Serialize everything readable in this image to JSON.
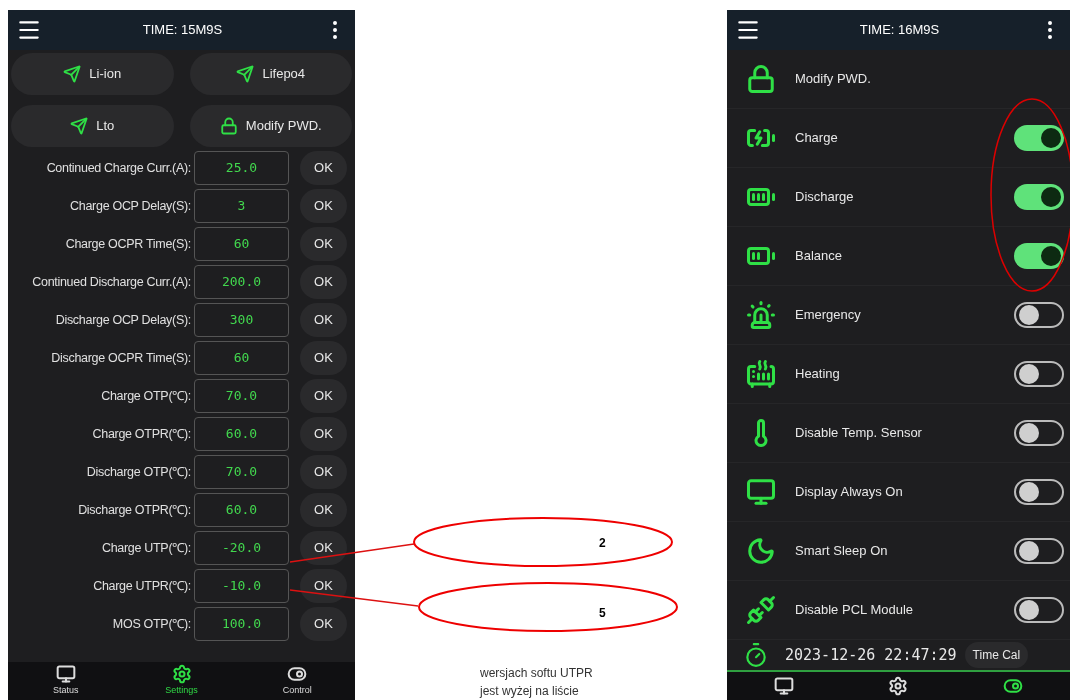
{
  "left_screen": {
    "title": "TIME: 15M9S",
    "mode_buttons": [
      {
        "label": "Li-ion",
        "kind": "plane"
      },
      {
        "label": "Lifepo4",
        "kind": "plane"
      },
      {
        "label": "Lto",
        "kind": "plane"
      },
      {
        "label": "Modify PWD.",
        "kind": "lock"
      }
    ],
    "parameters": [
      {
        "label": "Continued Charge Curr.(A):",
        "value": "25.0",
        "button": "OK"
      },
      {
        "label": "Charge OCP Delay(S):",
        "value": "3",
        "button": "OK"
      },
      {
        "label": "Charge OCPR Time(S):",
        "value": "60",
        "button": "OK"
      },
      {
        "label": "Continued Discharge Curr.(A):",
        "value": "200.0",
        "button": "OK"
      },
      {
        "label": "Discharge OCP Delay(S):",
        "value": "300",
        "button": "OK"
      },
      {
        "label": "Discharge OCPR Time(S):",
        "value": "60",
        "button": "OK"
      },
      {
        "label": "Charge OTP(℃):",
        "value": "70.0",
        "button": "OK"
      },
      {
        "label": "Charge OTPR(℃):",
        "value": "60.0",
        "button": "OK"
      },
      {
        "label": "Discharge OTP(℃):",
        "value": "70.0",
        "button": "OK"
      },
      {
        "label": "Discharge OTPR(℃):",
        "value": "60.0",
        "button": "OK"
      },
      {
        "label": "Charge UTP(℃):",
        "value": "-20.0",
        "button": "OK"
      },
      {
        "label": "Charge UTPR(℃):",
        "value": "-10.0",
        "button": "OK"
      },
      {
        "label": "MOS OTP(℃):",
        "value": "100.0",
        "button": "OK"
      }
    ],
    "nav": [
      {
        "label": "Status",
        "kind": "status",
        "selected": false
      },
      {
        "label": "Settings",
        "kind": "settings",
        "selected": true
      },
      {
        "label": "Control",
        "kind": "control",
        "selected": false
      }
    ]
  },
  "annotations": {
    "callouts": [
      "2",
      "5"
    ],
    "note_lines": [
      "wersjach softu UTPR",
      "jest wyżej na liście"
    ]
  },
  "right_screen": {
    "title": "TIME: 16M9S",
    "items": [
      {
        "label": "Modify PWD.",
        "kind": "lock"
      },
      {
        "label": "Charge",
        "kind": "charge",
        "on": true
      },
      {
        "label": "Discharge",
        "kind": "discharge",
        "on": true
      },
      {
        "label": "Balance",
        "kind": "balance",
        "on": true
      },
      {
        "label": "Emergency",
        "kind": "emergency",
        "on": false
      },
      {
        "label": "Heating",
        "kind": "heating",
        "on": false
      },
      {
        "label": "Disable Temp. Sensor",
        "kind": "thermometer",
        "on": false
      },
      {
        "label": "Display Always On",
        "kind": "display",
        "on": false
      },
      {
        "label": "Smart Sleep On",
        "kind": "sleep",
        "on": false
      },
      {
        "label": "Disable PCL Module",
        "kind": "plug",
        "on": false
      }
    ],
    "time_row": {
      "value": "2023-12-26 22:47:29",
      "button": "Time Cal"
    },
    "nav": [
      {
        "kind": "status",
        "selected": false
      },
      {
        "kind": "settings",
        "selected": false
      },
      {
        "kind": "control",
        "selected": true
      }
    ]
  }
}
